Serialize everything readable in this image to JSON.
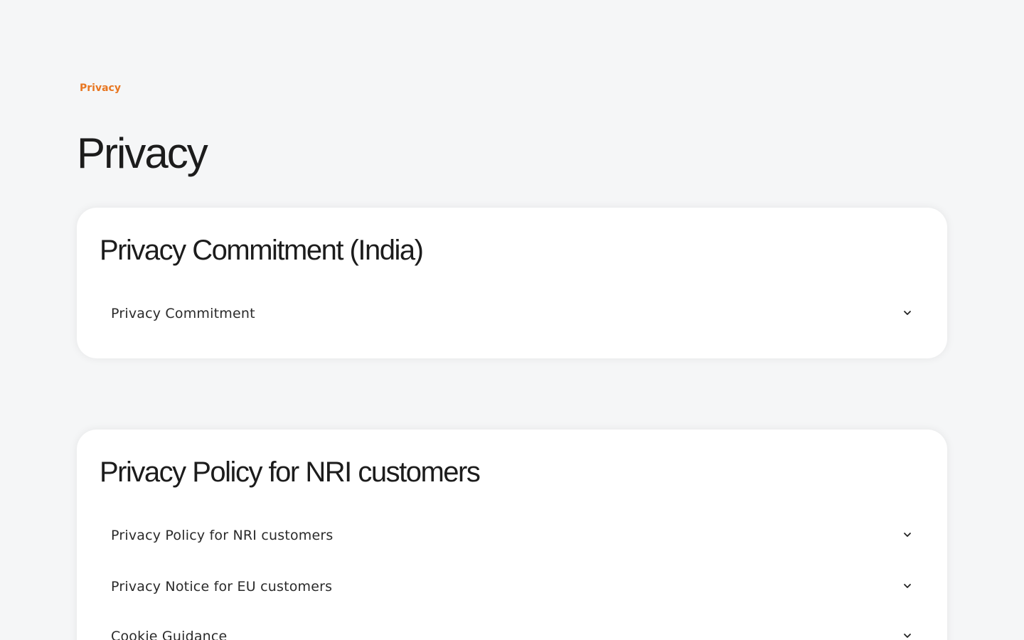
{
  "breadcrumb": {
    "label": "Privacy"
  },
  "page": {
    "title": "Privacy"
  },
  "sections": [
    {
      "title": "Privacy Commitment (India)",
      "items": [
        {
          "label": "Privacy Commitment",
          "icon": "chevron-down-icon"
        }
      ]
    },
    {
      "title": "Privacy Policy for NRI customers",
      "items": [
        {
          "label": "Privacy Policy for NRI customers",
          "icon": "chevron-down-icon"
        },
        {
          "label": "Privacy Notice for EU customers",
          "icon": "chevron-down-icon"
        },
        {
          "label": "Cookie Guidance",
          "icon": "chevron-down-icon"
        }
      ]
    }
  ],
  "colors": {
    "accent": "#e87722",
    "background": "#f5f6f7",
    "card": "#ffffff",
    "text": "#1c1c1c"
  }
}
